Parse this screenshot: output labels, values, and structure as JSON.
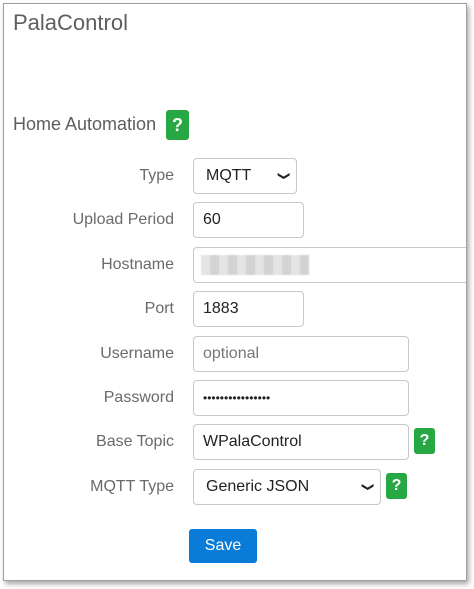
{
  "app": {
    "title": "PalaControl"
  },
  "section": {
    "title": "Home Automation",
    "help_label": "?"
  },
  "form": {
    "type": {
      "label": "Type",
      "value": "MQTT"
    },
    "upload_period": {
      "label": "Upload Period",
      "value": "60"
    },
    "hostname": {
      "label": "Hostname",
      "value": ""
    },
    "port": {
      "label": "Port",
      "value": "1883"
    },
    "username": {
      "label": "Username",
      "value": "",
      "placeholder": "optional"
    },
    "password": {
      "label": "Password",
      "value": "••••••••••••••••"
    },
    "base_topic": {
      "label": "Base Topic",
      "value": "WPalaControl",
      "help_label": "?"
    },
    "mqtt_type": {
      "label": "MQTT Type",
      "value": "Generic JSON",
      "help_label": "?"
    }
  },
  "actions": {
    "save_label": "Save"
  },
  "colors": {
    "help_green": "#28a745",
    "save_blue": "#0a7cd8",
    "label_gray": "#6a6a6a",
    "title_gray": "#5e5e5e"
  },
  "icons": {
    "select_arrow": "chevron-down-icon",
    "help": "question-mark-icon"
  }
}
